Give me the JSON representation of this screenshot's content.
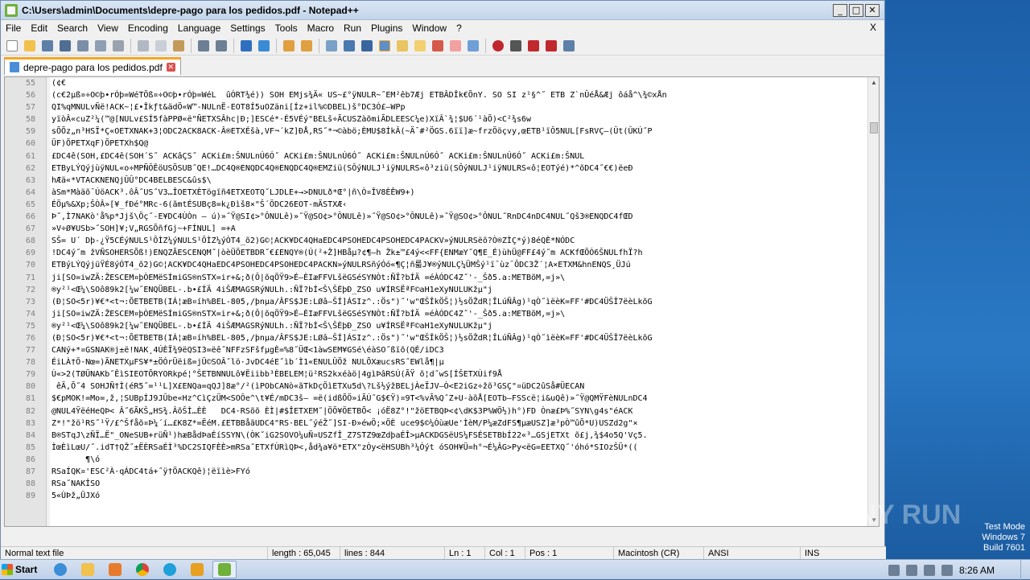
{
  "window": {
    "title": "C:\\Users\\admin\\Documents\\depre-pago para los pedidos.pdf - Notepad++",
    "min": "_",
    "max": "□",
    "close": "✕"
  },
  "menu": [
    "File",
    "Edit",
    "Search",
    "View",
    "Encoding",
    "Language",
    "Settings",
    "Tools",
    "Macro",
    "Run",
    "Plugins",
    "Window",
    "?"
  ],
  "menu_close": "X",
  "tab": {
    "label": "depre-pago para los pedidos.pdf"
  },
  "editor": {
    "lines": [
      {
        "n": "55",
        "t": "(¢€"
      },
      {
        "n": "56",
        "t": "(c€2μß¤÷O©þ•rÓþ=WéTÖß¤÷O©þ•rÓþ=WéL  ûÓRT¾é)) SOH EMjs¾Ä« US~£°ÿNULR~˝EM²êb7Æj ETBÂDÎk€ÕnY. SO SI z¹§^˝ ETB Z`nÛéÅ&Æj ôáå^\\¾©xÅn"
      },
      {
        "n": "57",
        "t": "QI%qMNULvÑë!ACK~¦£•Îkƒt&ädÖ«W™-NULnË-EOT8Í5uOZäni[Íz+il%©DBEL)š°DC3Ó£—WPp"
      },
      {
        "n": "58",
        "t": "yïòÂ«cuZ²¼(™@[NULv£SÍ5fàPPØ«ë\"ÑETXSÂhc|Ð;]ESCé*·É5VÉý\"BELš÷ÃCUSZàõmiÃDLEESC¼e)XïÂ`¾¦$U6´¹àÕ)<C²¾s6w"
      },
      {
        "n": "59",
        "t": "sÕÕz„n³HSÏ*Ç«OETXNAK+3¦ODC2ACK8ACK-Â®ETXÉšà,VF¬´kZ]ÐÅ,RS˝*¬©àbö;ÈMU$8ÍkÂ(~Ä¯#²ÖGS.6ïï]æ~frzÖöçvy,œETB¹ïÔ5NUL[FsRVÇ—(Ût(ÛKÚ˝P"
      },
      {
        "n": "60",
        "t": "ÜF)ÕPETXqF)ÕPETXh$Q@"
      },
      {
        "n": "61",
        "t": "£DC4ê(SOH,£DC4ê(SOH´S˝ ACKâÇS˝ ACKi£m:ŠNULnÚ6Ó˝ ACKi£m:ŠNULnÚ6Ó˝ ACKi£m:ŠNULnÚ6Ó˝ ACKi£m:ŠNULnÚ6Ó˝ ACKi£m:ŠNUL"
      },
      {
        "n": "62",
        "t": "ETByLÝQýjùÿNUL«o÷MPÑÔÊöUSÖSUB˝QE!…DC4Q®ENQDC4Q®ENQDC4Q®EMZiü(SÔýNULJ¹iÿNULRS«ô³ziü(SÔýNULJ¹iÿNULRS«ô¦EOTýé)*^õDC4˝€€)ëeÐ"
      },
      {
        "n": "63",
        "t": "hÆä«*VTACKNENQjÛÛ°DC4BELBESC&ûs$\\"
      },
      {
        "n": "64",
        "t": "àSm*Màäõ¯ÚöACK³.ôÂ˝US˝V3…ÎOETXÈTögïñ4ETXEOTQ˝LJDLE+→>DNULð*Œ°|ñ\\Ò¤ÎV8ÈÊW9+)"
      },
      {
        "n": "65",
        "t": "ÉÖµ%&Xp;ŠÒÂ»[¥_fÐé°MRc-6(ãmtÉSUBç8=k¿Ðìš8×\"Š´ÖDC26EOT-mÄSTXÆ‹"
      },
      {
        "n": "66",
        "t": "Þ˝,Ì7NAKò'å%p*Jjš\\Öç˝-E¥DC4ÙÒn — ú)»˝Ÿ@SI¢>°ÔNULê)»˝Ÿ@SO¢>°ÔNULê)»˝Ÿ@SO¢>°ÔNULê)»˝Ÿ@SO¢>°ÔNUL˝RnDC4nDC4NUL˝Qš3®ENQDC4fŒD"
      },
      {
        "n": "67",
        "t": "»V÷Ø¥USb>˝SOH]¥;V„RGSÕñfGj~+FÍNUL] =+A"
      },
      {
        "n": "68",
        "t": "SŠ= U´ Dþ-¿Ÿ5CÉýNULS¹ÔÌZ¼ýNULS¹ÔÌZ¼ýÒT4_õ2)G©¦ACK¥DC4QHaEDC4PSOHEDC4PSOHEDC4PACKV»ýNULRSëõ?Ò®ZÌÇ*ý)8éQÈ*NÓDC"
      },
      {
        "n": "69",
        "t": "!DC4ý˝m žVÑSOHERSÕß!)ENQZÃESCENQM˝|òèÜÖETBDR˝€£ENQY®(Ú(²+Ž]HBåµ?¢¶—h Žk±™£4ý<<FF{ENMæY˝Q¶E_É)ùhÜ@FF£4ý˝m ACKfŒÖÓ6ŠNULfhÏ?h"
      },
      {
        "n": "70",
        "t": "ETBýLÝQýjüŸÉ8ýÓT4_õ2)G©¦ACK¥DC4QHaEDC4PSOHEDC4PSOHEDC4PACKN»ýNULRSñýÓó«¶Ç¦ñ륿J¥®ýNULÇ¼ÜMŠý¹ï¯ùz¯ÔDC3Ž´¦A×ETXM&hnENQS¸ÜJú"
      },
      {
        "n": "71",
        "t": "ji[SO=iwZÄ:ŽESCEM¤þÒEMëSÍmiGS®nSTX=ir+&;ð(Ô|õqÖŸ9>É—ÈIæFFVLšëGSéSYNÒt:ÑÏ?bÍÄ =éÀÓDC4Z˝'-_Šð5.a:METBõM,=j»\\"
      },
      {
        "n": "72",
        "t": "®y²¹<Œ¼\\SOô89k2[¼w˝ENQÜBEL-.b•£ÍÄ 4iŠÆMAGSRýNULh.:ÑÏ?bÍ<Š\\ŠÈþÐ_ZSO u¥ÍRSËªF©aH1eXyNULUKžµ\"j"
      },
      {
        "n": "73",
        "t": "(Ð¦SO<5r)¥€*<t¬:ÕETBETB(IÁ¦æB¤íh%BEL-805,/þnµa/ÂFS$JE:LØâ—ŠÍ]ÁSIz^.:Ös\")˝'w\"ŒŠÎkÖŠ¦)½sÖŽdR¦ÎLúÑÂg)¹qÒ˝ìëèK=FF'#DC4ÜŠÎ7ëèLkõG"
      },
      {
        "n": "74",
        "t": "ji[SO=iwZÄ:ŽESCEM¤þÒEMëSÍmiGS®nSTX=ir+&;ð(Ô|õqÖŸ9>É—ÈIæFFVLšëGSéSYNÒt:ÑÏ?bÍÄ =éÀÓDC4Z˝'-_Šð5.a:METBõM,=j»\\"
      },
      {
        "n": "75",
        "t": "®y²¹<Œ¼\\SOô89k2[¼w˝ENQÜBEL-.b•£ÍÄ 4iŠÆMAGSRýNULh.:ÑÏ?bÍ<Š\\ŠÈþÐ_ZSO u¥ÍRSËªF©aH1eXyNULUKžµ\"j"
      },
      {
        "n": "76",
        "t": "(Ð¦SO<5r)¥€*<t¬:ÕETBETB(IÁ¦æB¤íh%BEL-805,/þnµa/ÂFS$JE:LØâ—ŠÍ]ÁSIz^.:Ös\")˝'w\"ŒŠÎkÖŠ¦)½sÖŽdR¦ÎLúÑÂg)¹qÒ˝ìëèK=FF'#DC4ÜŠÎ7ëèLkõG"
      },
      {
        "n": "77",
        "t": "CANý+*¤GSNAK®j±ë!NAK¸4ÚÈÏ¾9ëQSI3=ëê˝NFFzSFšfµgÈ=%8˝ÜŒ<1àwSEM¥GSé\\éàSO˝ßïõ(QÉ/iDC3"
      },
      {
        "n": "78",
        "t": "ÉiLÀ†Ö·Nœ=)ÃNETXµFS¥*±ÖÓrÜëiß=jÜ©SOÂ˝lö·JvDC4éE˝ìb´Ì1«ENULÛÖž NULÕXæucsRS˝EWlå¶|µ"
      },
      {
        "n": "79",
        "t": "Ù«>2(TØÜNAKb˝ÊìSIEOTÕRYORkpé¦°ŠETBNNULô¥Ëiibb³ÈBELEM¦ü²RS2kxéàö|4gìÞâRSÚ(ÃŸ õ¦d˝wS[ÍŠETXÙif9Å"
      },
      {
        "n": "80",
        "t": " êÄ,Õ˝4 SOHJÑ†Ì(éR5˝=¹¹L]X£ENQa=qQJ]8æ°/²(ìPObCANò«ãTkDçÖìETXu5d\\?Lš½ýžBELjÀeÏJV—Ò<E2iGz÷žõ³GSÇ\"¤üDC2ûSå#ÜECAN"
      },
      {
        "n": "81",
        "t": "$€pMOK!=Mo=,ž,¦SUBpÍJ9JÛbe«Hz^CìÇzÜM<SOÔe^\\t¥É/mDC3š— =ë(idßÕÖ»iÃÚ˝G$€Ÿ)¤9T<%vÃ%Q˝Z+U-àõÅ[EOTb—FSScë¦i&uQê)»˝Ÿ@QMŸFèNULnDC4"
      },
      {
        "n": "82",
        "t": "@NUL4ŸëéHeQÞ< Â˝6ÃKŠ„HS¾.ÂõŠÌ…ÈÈ   DC4·RSõõ ÈÌ|#$ÎETXEM˝|ÖÕ¥ÖETBÕ< ¡óË8Z°!\"žöETBQÞ<¢\\dK$3P%WÖ½)h°)FD Ònæ£Þ%˝SYN\\g4s\"éACK"
      },
      {
        "n": "83",
        "t": "Z*!\"žö¹RS˝¹Ÿ/£^Šfåõ¤Þ¼´í…£K8Z*=ËéM.£ETBBåãUDC4\"RS·BEL˝ýéŽ˝]SI-Ð»éwÖ;×ÖÈ uce9$©¼ÒùæUe'ÌèM/P¼æZdFS¶µæUSZ]æ³pÒ™ûÕ*U)USZd2g\"×"
      },
      {
        "n": "84",
        "t": "B®STqJ\\zÑÏ…Ë\"_ONeSUB+rüÑ¹)hæBådÞaÉíSSYN\\(ÒK˝iG2SOVO¼uÑ¤USZfÎ_Z7STZ9œZdþaÉÎ>µACKDGSëUS¼FSÉSETBbÍ22«³…GSjETXt õ£j,¾$4o5Q'Vç5."
      },
      {
        "n": "85",
        "t": "ÌœÈìLœU/˝.idT†QŽ˝±ËÈRSaÉÌ³%DC2SIQFÈÈ>mRSa˝ETXfÙRìQÞ<,åd¾a¥ö*ETX\"zÒy<ëHSUBh³¼Óýt óSOH¥Ü=h°¬É¼ÂG>Py<ëG=EETXQ˝'óhó*SIOzŠÜ*(("
      },
      {
        "n": "86",
        "t": "       ¶\\ó"
      },
      {
        "n": "87",
        "t": "RSaÍQK¤'ESC²À·qÁDC4tá+˝ÿ†ÖACKQê)¦ëïìè>FYó"
      },
      {
        "n": "88",
        "t": "RSa˝NAKÎSO"
      },
      {
        "n": "89",
        "t": "5«ÙÞž„ÜJXó"
      }
    ]
  },
  "status": {
    "type": "Normal text file",
    "length": "length : 65,045",
    "lines": "lines : 844",
    "ln": "Ln : 1",
    "col": "Col : 1",
    "pos": "Pos : 1",
    "eol": "Macintosh (CR)",
    "encoding": "ANSI",
    "ins": "INS"
  },
  "taskbar": {
    "start": "Start",
    "clock": "8:26 AM"
  },
  "watermark": {
    "text": "ANY RUN"
  },
  "testmode": {
    "line1": "Test Mode",
    "line2": "Windows 7",
    "line3": "Build 7601"
  },
  "colors": {
    "tab_accent": "#f6a623",
    "title_bar": "#c4d5ea"
  }
}
